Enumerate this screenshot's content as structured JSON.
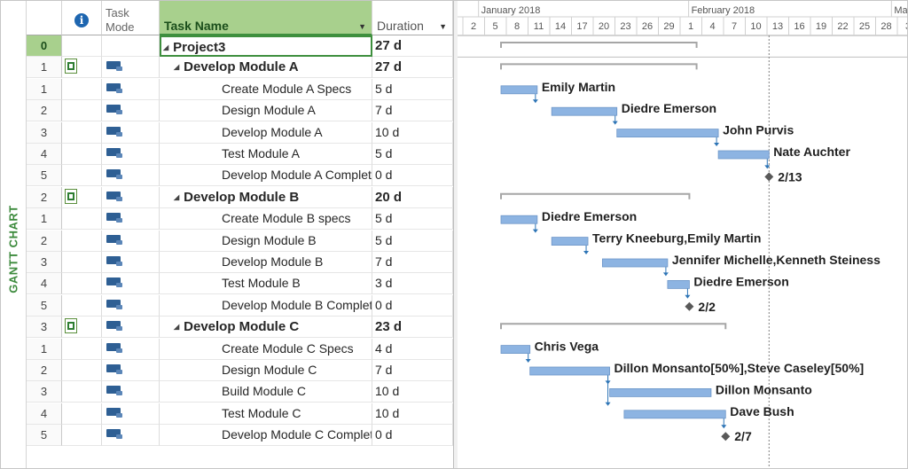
{
  "view_label": "GANTT CHART",
  "columns": {
    "info_icon": "i",
    "mode": "Task Mode",
    "name": "Task Name",
    "duration": "Duration"
  },
  "timescale": {
    "months": [
      {
        "label": "January 2018",
        "day_index": -2
      },
      {
        "label": "February 2018",
        "day_index": 27
      },
      {
        "label": "March",
        "day_index": 55
      }
    ],
    "days": [
      "2",
      "5",
      "8",
      "11",
      "14",
      "17",
      "20",
      "23",
      "26",
      "29",
      "1",
      "4",
      "7",
      "10",
      "13",
      "16",
      "19",
      "22",
      "25",
      "28",
      "3"
    ],
    "status_date": "2/13"
  },
  "rows": [
    {
      "id": "0",
      "name": "Project3",
      "duration": "27 d",
      "level": 0,
      "summary": true,
      "project": true,
      "note": false,
      "start": 0,
      "dur": 27
    },
    {
      "id": "1",
      "name": "Develop Module A",
      "duration": "27 d",
      "level": 1,
      "summary": true,
      "note": true,
      "start": 0,
      "dur": 27
    },
    {
      "id": "1",
      "name": "Create Module A Specs",
      "duration": "5 d",
      "level": 2,
      "start": 0,
      "dur": 5,
      "resource": "Emily Martin"
    },
    {
      "id": "2",
      "name": "Design Module A",
      "duration": "7 d",
      "level": 2,
      "start": 7,
      "dur": 9,
      "resource": "Diedre Emerson"
    },
    {
      "id": "3",
      "name": "Develop Module A",
      "duration": "10 d",
      "level": 2,
      "start": 16,
      "dur": 14,
      "resource": "John Purvis"
    },
    {
      "id": "4",
      "name": "Test Module A",
      "duration": "5 d",
      "level": 2,
      "start": 30,
      "dur": 7,
      "resource": "Nate Auchter"
    },
    {
      "id": "5",
      "name": "Develop Module A Complete",
      "duration": "0 d",
      "level": 2,
      "milestone": true,
      "start": 37,
      "resource": "2/13"
    },
    {
      "id": "2",
      "name": "Develop Module B",
      "duration": "20 d",
      "level": 1,
      "summary": true,
      "note": true,
      "start": 0,
      "dur": 26
    },
    {
      "id": "1",
      "name": "Create Module B specs",
      "duration": "5 d",
      "level": 2,
      "start": 0,
      "dur": 5,
      "resource": "Diedre Emerson"
    },
    {
      "id": "2",
      "name": "Design Module B",
      "duration": "5 d",
      "level": 2,
      "start": 7,
      "dur": 5,
      "resource": "Terry Kneeburg,Emily Martin"
    },
    {
      "id": "3",
      "name": "Develop Module B",
      "duration": "7 d",
      "level": 2,
      "start": 14,
      "dur": 9,
      "resource": "Jennifer Michelle,Kenneth Steiness"
    },
    {
      "id": "4",
      "name": "Test Module B",
      "duration": "3 d",
      "level": 2,
      "start": 23,
      "dur": 3,
      "resource": "Diedre Emerson"
    },
    {
      "id": "5",
      "name": "Develop Module B Complete",
      "duration": "0 d",
      "level": 2,
      "milestone": true,
      "start": 26,
      "resource": "2/2"
    },
    {
      "id": "3",
      "name": "Develop Module C",
      "duration": "23 d",
      "level": 1,
      "summary": true,
      "note": true,
      "start": 0,
      "dur": 31
    },
    {
      "id": "1",
      "name": "Create Module C Specs",
      "duration": "4 d",
      "level": 2,
      "start": 0,
      "dur": 4,
      "resource": "Chris Vega"
    },
    {
      "id": "2",
      "name": "Design Module C",
      "duration": "7 d",
      "level": 2,
      "start": 4,
      "dur": 11,
      "resource": "Dillon Monsanto[50%],Steve Caseley[50%]"
    },
    {
      "id": "3",
      "name": "Build Module C",
      "duration": "10 d",
      "level": 2,
      "start": 15,
      "dur": 14,
      "resource": "Dillon Monsanto"
    },
    {
      "id": "4",
      "name": "Test Module C",
      "duration": "10 d",
      "level": 2,
      "start": 17,
      "dur": 14,
      "resource": "Dave Bush"
    },
    {
      "id": "5",
      "name": "Develop Module C Complete",
      "duration": "0 d",
      "level": 2,
      "milestone": true,
      "start": 31,
      "resource": "2/7"
    }
  ],
  "links": [
    [
      2,
      3
    ],
    [
      3,
      4
    ],
    [
      4,
      5
    ],
    [
      5,
      6
    ],
    [
      8,
      9
    ],
    [
      9,
      10
    ],
    [
      10,
      11
    ],
    [
      11,
      12
    ],
    [
      14,
      15
    ],
    [
      15,
      16
    ],
    [
      15,
      17
    ],
    [
      17,
      18
    ]
  ],
  "colors": {
    "bar": "#8db4e2",
    "bar_border": "#6d96c8",
    "summary": "#a6a6a6",
    "milestone": "#595959",
    "link": "#2e75b6",
    "status_line": "#7f7f7f",
    "header_green": "#a8d08d"
  }
}
